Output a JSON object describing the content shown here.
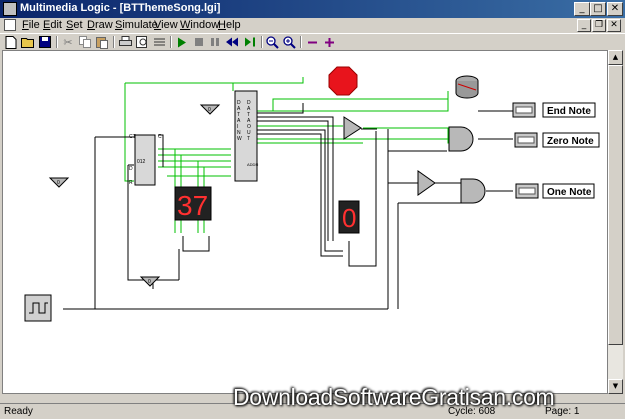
{
  "window": {
    "title": "Multimedia Logic - [BTThemeSong.lgi]",
    "minimize": "_",
    "maximize": "□",
    "close": "✕"
  },
  "menu": {
    "items": [
      {
        "label": "File",
        "accel": "F",
        "rest": "ile"
      },
      {
        "label": "Edit",
        "accel": "E",
        "rest": "dit"
      },
      {
        "label": "Set",
        "accel": "S",
        "rest": "et"
      },
      {
        "label": "Draw",
        "accel": "D",
        "rest": "raw"
      },
      {
        "label": "Simulate",
        "accel": "S",
        "rest": "imulate"
      },
      {
        "label": "View",
        "accel": "V",
        "rest": "iew"
      },
      {
        "label": "Window",
        "accel": "W",
        "rest": "indow"
      },
      {
        "label": "Help",
        "accel": "H",
        "rest": "elp"
      }
    ]
  },
  "toolbar": {
    "icons": [
      "new-icon",
      "open-icon",
      "save-icon",
      "cut-icon",
      "copy-icon",
      "paste-icon",
      "print-icon",
      "print-preview-icon",
      "properties-icon",
      "run-icon",
      "stop-icon",
      "pause-icon",
      "step-back-icon",
      "step-forward-icon",
      "zoom-out-icon",
      "zoom-in-icon",
      "minus-icon",
      "plus-icon"
    ]
  },
  "circuit": {
    "note_labels": [
      "End Note",
      "Zero Note",
      "One Note"
    ],
    "seven_seg_left": "37",
    "seven_seg_right": "0",
    "counter_label": "012",
    "counter_pins_left": [
      "CT",
      "D",
      "R"
    ],
    "counter_pins_right": [
      "C"
    ],
    "rom_pins_left": [
      "D",
      "A",
      "T",
      "A",
      "I",
      "N",
      "W"
    ],
    "rom_pins_right": [
      "D",
      "A",
      "T",
      "A",
      "O",
      "U",
      "T"
    ],
    "rom_addr_label": "ADDR",
    "ground_label": "0",
    "stop_sign_color": "#e8141c",
    "wire_green": "#00c000",
    "wire_black": "#000000"
  },
  "status": {
    "ready": "Ready",
    "cycle": "Cycle: 608",
    "page": "Page: 1"
  },
  "watermark": "DownloadSoftwareGratisan.com"
}
